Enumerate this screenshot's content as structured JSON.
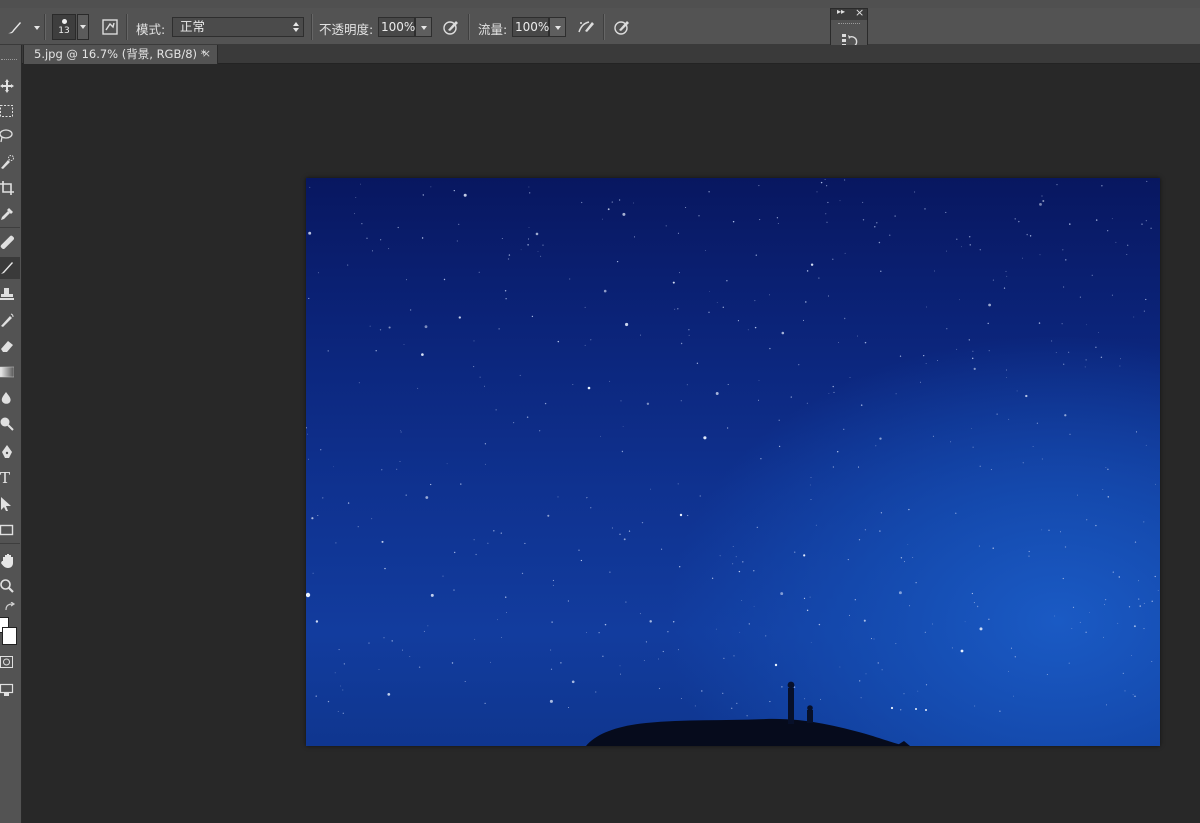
{
  "options_bar": {
    "brush_size": "13",
    "mode_label": "模式:",
    "mode_value": "正常",
    "opacity_label": "不透明度:",
    "opacity_value": "100%",
    "flow_label": "流量:",
    "flow_value": "100%"
  },
  "document_tab": {
    "title": "5.jpg @ 16.7% (背景, RGB/8) *",
    "close_glyph": "×"
  },
  "mini_panel": {
    "expand_glyph": "▸▸",
    "close_glyph": "×"
  },
  "toolbar": {
    "type_tool_glyph": "T"
  },
  "colors": {
    "ui_panel": "#535353",
    "workspace": "#282828",
    "sky_top": "#081760",
    "sky_glow": "#1a5ac4"
  }
}
